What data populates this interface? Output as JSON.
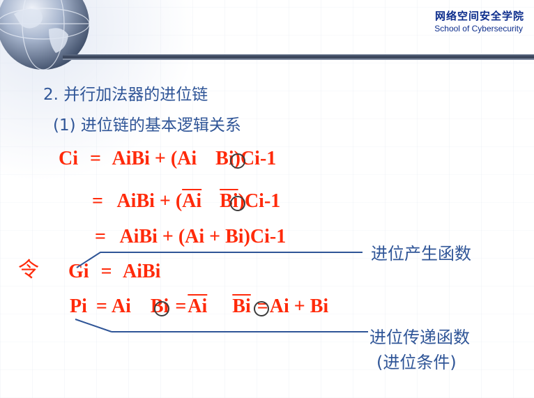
{
  "header": {
    "school_name_cn": "网络空间安全学院",
    "school_name_en": "School of Cybersecurity"
  },
  "heading": {
    "title": "2. 并行加法器的进位链",
    "subtitle": "(1) 进位链的基本逻辑关系"
  },
  "formulas": {
    "line1": {
      "lhs": "Ci",
      "eq": "=",
      "t1": "AiBi + (Ai ",
      "t2": "Bi)Ci-1"
    },
    "line2": {
      "eq": "=",
      "t1": "AiBi + (",
      "a": "Ai",
      "b": "Bi",
      "t3": ")Ci-1"
    },
    "line3": {
      "eq": "=",
      "text": "AiBi + (Ai +  Bi)Ci-1"
    },
    "ling": "令",
    "line4": {
      "lhs": "Gi",
      "eq": "=",
      "text": "AiBi"
    },
    "line5": {
      "lhs": "Pi",
      "eq": "=",
      "a": "Ai",
      "b": "Bi",
      "eq2": "=",
      "na": "Ai",
      "nb": "Bi",
      "eq3": "=",
      "tail": "Ai + Bi"
    }
  },
  "annotations": {
    "generate": "进位产生函数",
    "propagate": "进位传递函数",
    "propagate_note": "(进位条件)"
  },
  "colors": {
    "formula": "#ff2a0a",
    "heading": "#2f5597",
    "school": "#0c2d8c"
  }
}
